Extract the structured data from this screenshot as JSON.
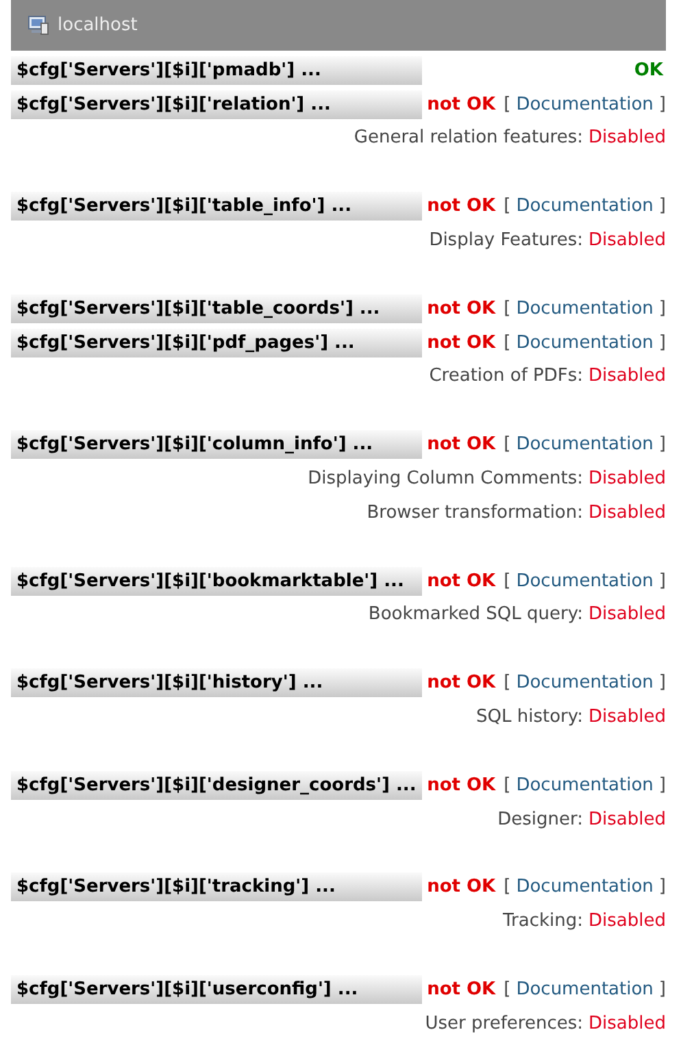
{
  "header": {
    "title": "localhost"
  },
  "groups": [
    {
      "checks": [
        {
          "param": "$cfg['Servers'][$i]['pmadb'] ...",
          "ok": true,
          "status": "OK"
        },
        {
          "param": "$cfg['Servers'][$i]['relation'] ...",
          "ok": false,
          "status": "not OK",
          "doc": {
            "open": "[",
            "link": "Documentation",
            "close": "]"
          }
        }
      ],
      "features": [
        {
          "label": "General relation features:",
          "value": "Disabled",
          "enabled": false
        }
      ]
    },
    {
      "checks": [
        {
          "param": "$cfg['Servers'][$i]['table_info'] ...",
          "ok": false,
          "status": "not OK",
          "doc": {
            "open": "[",
            "link": "Documentation",
            "close": "]"
          }
        }
      ],
      "features": [
        {
          "label": "Display Features:",
          "value": "Disabled",
          "enabled": false
        }
      ]
    },
    {
      "checks": [
        {
          "param": "$cfg['Servers'][$i]['table_coords'] ...",
          "ok": false,
          "status": "not OK",
          "doc": {
            "open": "[",
            "link": "Documentation",
            "close": "]"
          }
        },
        {
          "param": "$cfg['Servers'][$i]['pdf_pages'] ...",
          "ok": false,
          "status": "not OK",
          "doc": {
            "open": "[",
            "link": "Documentation",
            "close": "]"
          }
        }
      ],
      "features": [
        {
          "label": "Creation of PDFs:",
          "value": "Disabled",
          "enabled": false
        }
      ]
    },
    {
      "checks": [
        {
          "param": "$cfg['Servers'][$i]['column_info'] ...",
          "ok": false,
          "status": "not OK",
          "doc": {
            "open": "[",
            "link": "Documentation",
            "close": "]"
          }
        }
      ],
      "features": [
        {
          "label": "Displaying Column Comments:",
          "value": "Disabled",
          "enabled": false
        },
        {
          "label": "Browser transformation:",
          "value": "Disabled",
          "enabled": false
        }
      ]
    },
    {
      "checks": [
        {
          "param": "$cfg['Servers'][$i]['bookmarktable'] ...",
          "ok": false,
          "status": "not OK",
          "doc": {
            "open": "[",
            "link": "Documentation",
            "close": "]"
          }
        }
      ],
      "features": [
        {
          "label": "Bookmarked SQL query:",
          "value": "Disabled",
          "enabled": false
        }
      ]
    },
    {
      "checks": [
        {
          "param": "$cfg['Servers'][$i]['history'] ...",
          "ok": false,
          "status": "not OK",
          "doc": {
            "open": "[",
            "link": "Documentation",
            "close": "]"
          }
        }
      ],
      "features": [
        {
          "label": "SQL history:",
          "value": "Disabled",
          "enabled": false
        }
      ]
    },
    {
      "checks": [
        {
          "param": "$cfg['Servers'][$i]['designer_coords'] ...",
          "ok": false,
          "status": "not OK",
          "doc": {
            "open": "[",
            "link": "Documentation",
            "close": "]"
          }
        }
      ],
      "features": [
        {
          "label": "Designer:",
          "value": "Disabled",
          "enabled": false
        }
      ]
    },
    {
      "checks": [
        {
          "param": "$cfg['Servers'][$i]['tracking'] ...",
          "ok": false,
          "status": "not OK",
          "doc": {
            "open": "[",
            "link": "Documentation",
            "close": "]"
          }
        }
      ],
      "features": [
        {
          "label": "Tracking:",
          "value": "Disabled",
          "enabled": false
        }
      ]
    },
    {
      "checks": [
        {
          "param": "$cfg['Servers'][$i]['userconfig'] ...",
          "ok": false,
          "status": "not OK",
          "doc": {
            "open": "[",
            "link": "Documentation",
            "close": "]"
          }
        }
      ],
      "features": [
        {
          "label": "User preferences:",
          "value": "Disabled",
          "enabled": false
        }
      ]
    }
  ]
}
